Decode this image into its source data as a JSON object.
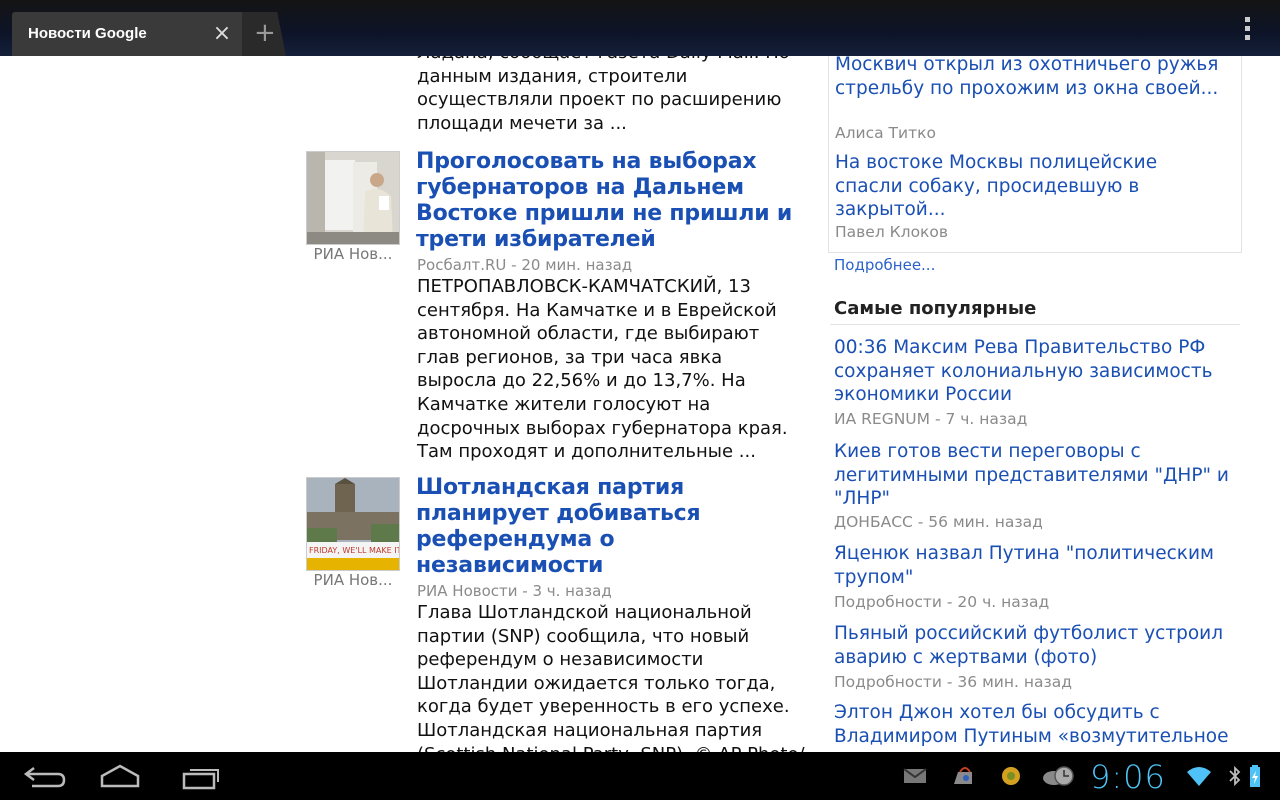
{
  "browser": {
    "tab_title": "Новости Google",
    "close_symbol": "×",
    "new_tab_symbol": "+",
    "menu_icon": "overflow-menu-icon"
  },
  "articles": {
    "prev_tail": "Ладана, сообщает газета Daily Mail. По данным издания, строители осуществляли проект по расширению площади мечети за ...",
    "items": [
      {
        "thumb_caption": "РИА Нов...",
        "headline": "Проголосовать на выборах губернаторов на Дальнем Востоке пришли не пришли и трети избирателей",
        "source": "Росбалт.RU - 20 мин. назад",
        "snippet": "ПЕТРОПАВЛОВСК-КАМЧАТСКИЙ, 13 сентября. На Камчатке и в Еврейской автономной области, где выбирают глав регионов, за три часа явка выросла до 22,56% и до 13,7%. На Камчатке жители голосуют на досрочных выборах губернатора края. Там проходят и дополнительные ..."
      },
      {
        "thumb_caption": "РИА Нов...",
        "headline": "Шотландская партия планирует добиваться референдума о независимости",
        "source": "РИА Новости - 3 ч. назад",
        "snippet": "Глава Шотландской национальной партии (SNP) сообщила, что новый референдум о независимости Шотландии ожидается только тогда, когда будет уверенность в его успехе. Шотландская национальная партия (Scottish National Party, SNP). © AP Photo/",
        "banner_text": "FRIDAY, WE'LL MAKE IT HISTOR"
      }
    ]
  },
  "sidebar": {
    "top_links": [
      {
        "title": "Москвич открыл из охотничьего ружья стрельбу по прохожим из окна своей...",
        "author": "Алиса Титко"
      },
      {
        "title": "На востоке Москвы полицейские спасли собаку, просидевшую в закрытой...",
        "author": "Павел Клоков"
      }
    ],
    "more_label": "Подробнее...",
    "popular_title": "Самые популярные",
    "popular": [
      {
        "title": "00:36 Максим Рева Правительство РФ сохраняет колониальную зависимость экономики России",
        "meta": "ИА REGNUM - 7 ч. назад"
      },
      {
        "title": "Киев готов вести переговоры с легитимными представителями \"ДНР\" и \"ЛНР\"",
        "meta": "ДОНБАСС - 56 мин. назад"
      },
      {
        "title": "Яценюк назвал Путина \"политическим трупом\"",
        "meta": "Подробности - 20 ч. назад"
      },
      {
        "title": "Пьяный российский футболист устроил аварию с жертвами (фото)",
        "meta": "Подробности - 36 мин. назад"
      },
      {
        "title": "Элтон Джон хотел бы обсудить с Владимиром Путиным «возмутительное",
        "meta": ""
      }
    ]
  },
  "system_bar": {
    "time": "9:06",
    "icons": [
      "back-icon",
      "home-icon",
      "recent-apps-icon",
      "email-icon",
      "shopping-bag-icon",
      "flower-icon",
      "weather-clock-icon",
      "wifi-icon",
      "bluetooth-icon",
      "battery-charging-icon"
    ],
    "clock_color": "#4fc3f7"
  }
}
